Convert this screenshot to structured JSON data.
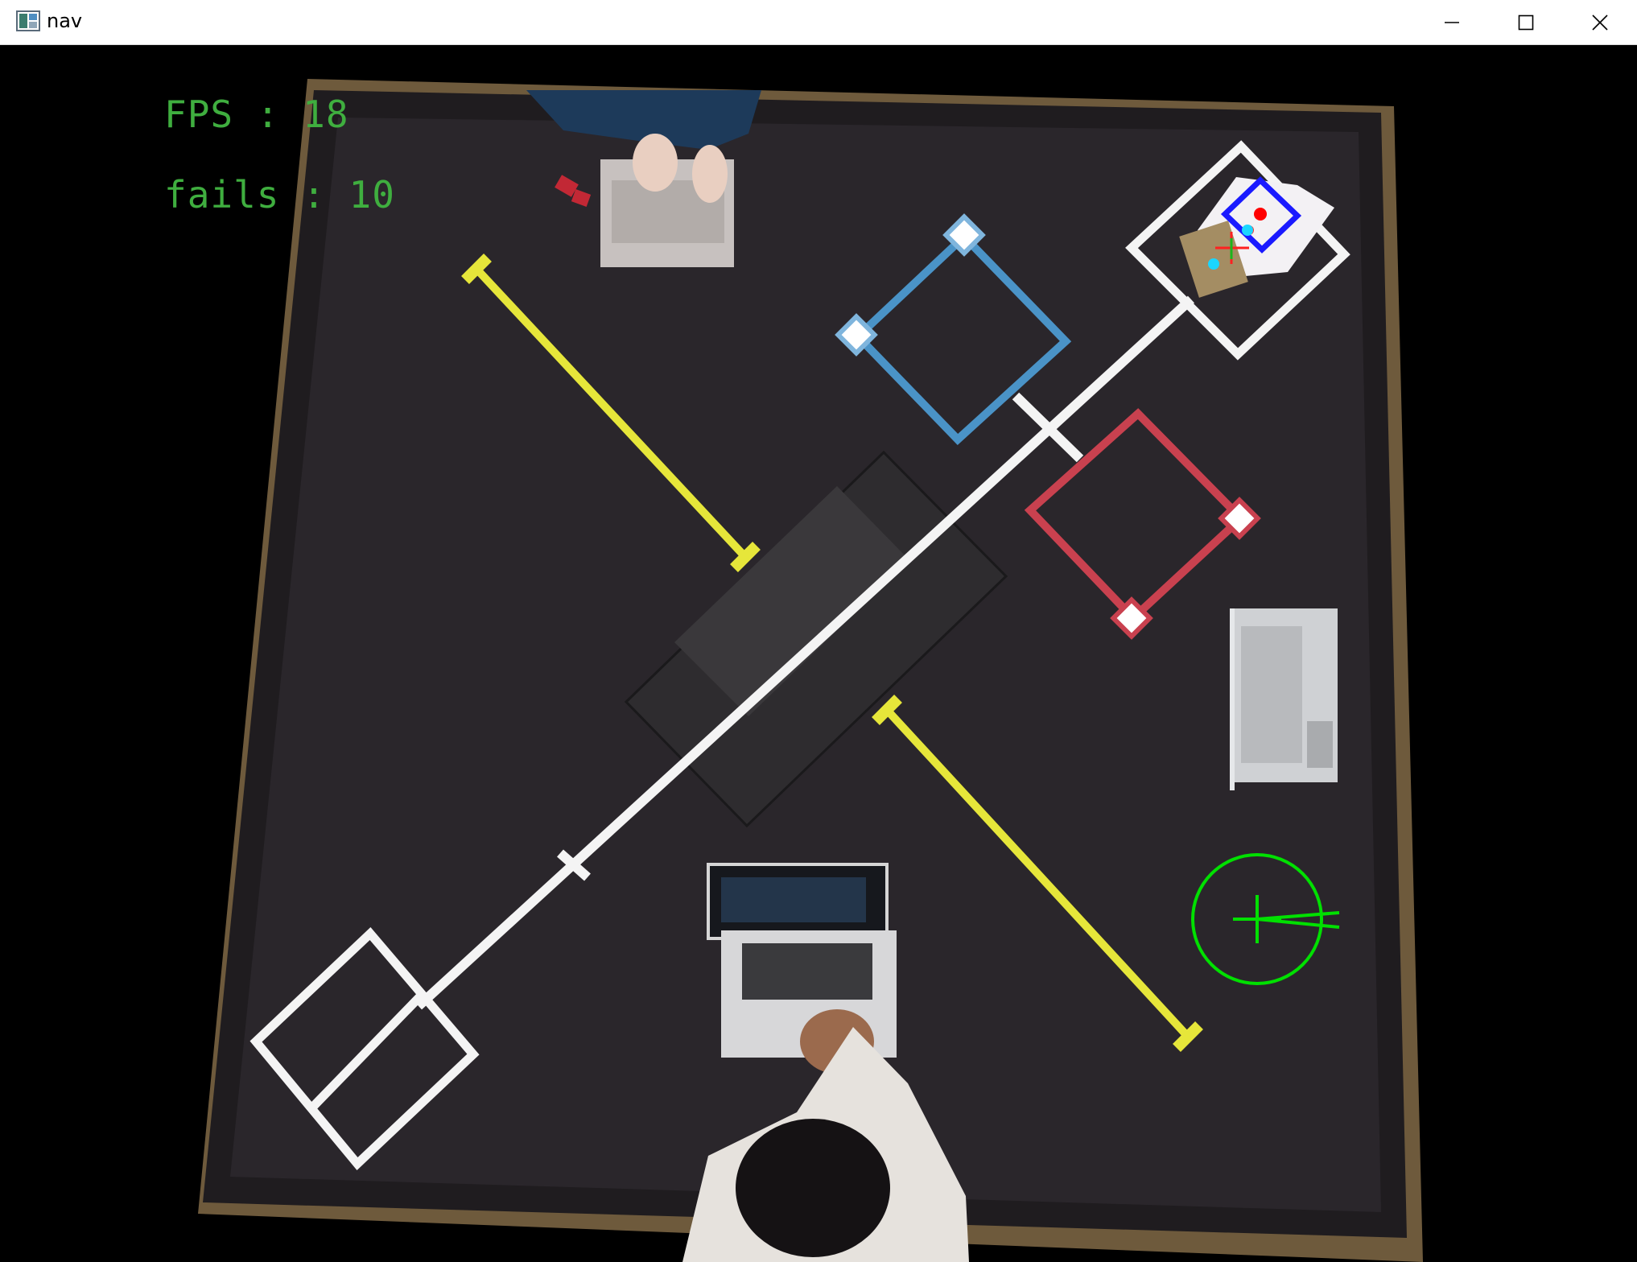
{
  "window": {
    "title": "nav",
    "icons": {
      "app": "app-window-icon",
      "minimize": "minimize-icon",
      "maximize": "maximize-icon",
      "close": "close-icon"
    }
  },
  "overlay": {
    "fps_text": "FPS : 18",
    "fails_text": "fails : 10"
  },
  "colors": {
    "overlay_text": "#3fae3f",
    "track_line": "#f4f4f4",
    "yellow_marker": "#e6e63a",
    "blue_zone": "#4a93c7",
    "red_zone": "#c9414f",
    "target_circle": "#00e000",
    "robot_box": "#1a1aff"
  }
}
